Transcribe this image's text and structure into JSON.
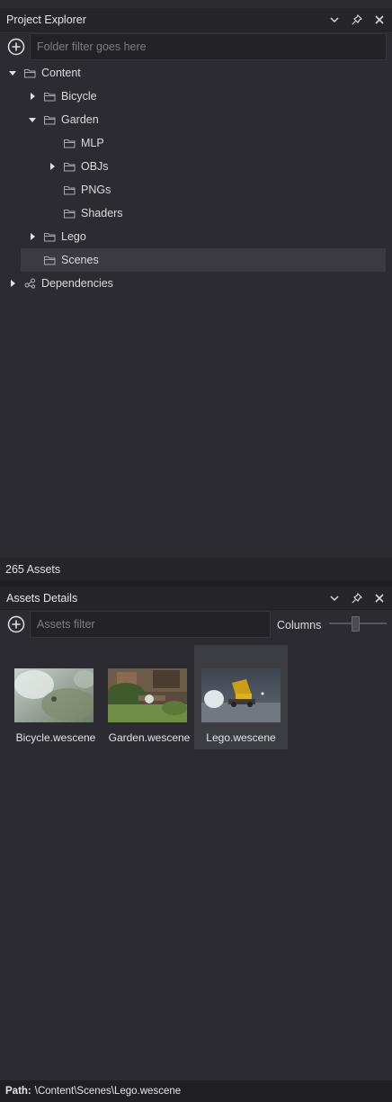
{
  "project_explorer": {
    "title": "Project Explorer",
    "filter_placeholder": "Folder filter goes here",
    "tree": [
      {
        "label": "Content",
        "depth": 0,
        "expanded": true,
        "has_children": true,
        "icon": "folder-icon"
      },
      {
        "label": "Bicycle",
        "depth": 1,
        "expanded": false,
        "has_children": true,
        "icon": "folder-icon"
      },
      {
        "label": "Garden",
        "depth": 1,
        "expanded": true,
        "has_children": true,
        "icon": "folder-icon"
      },
      {
        "label": "MLP",
        "depth": 2,
        "expanded": false,
        "has_children": false,
        "icon": "folder-icon"
      },
      {
        "label": "OBJs",
        "depth": 2,
        "expanded": false,
        "has_children": true,
        "icon": "folder-icon"
      },
      {
        "label": "PNGs",
        "depth": 2,
        "expanded": false,
        "has_children": false,
        "icon": "folder-icon"
      },
      {
        "label": "Shaders",
        "depth": 2,
        "expanded": false,
        "has_children": false,
        "icon": "folder-icon"
      },
      {
        "label": "Lego",
        "depth": 1,
        "expanded": false,
        "has_children": true,
        "icon": "folder-icon"
      },
      {
        "label": "Scenes",
        "depth": 1,
        "expanded": false,
        "has_children": false,
        "icon": "folder-icon",
        "selected": true
      },
      {
        "label": "Dependencies",
        "depth": 0,
        "expanded": false,
        "has_children": true,
        "icon": "dependencies-icon"
      }
    ]
  },
  "status": {
    "asset_count": "265 Assets"
  },
  "assets_details": {
    "title": "Assets Details",
    "filter_placeholder": "Assets filter",
    "columns_label": "Columns",
    "columns_slider_level": 0.45,
    "assets": [
      {
        "name": "Bicycle.wescene",
        "thumb": "bicycle",
        "selected": false
      },
      {
        "name": "Garden.wescene",
        "thumb": "garden",
        "selected": false
      },
      {
        "name": "Lego.wescene",
        "thumb": "lego",
        "selected": true
      }
    ]
  },
  "path_bar": {
    "label": "Path:",
    "value": "\\Content\\Scenes\\Lego.wescene"
  },
  "colors": {
    "background": "#2b2b31",
    "header": "#25252a",
    "selected_row": "#3a3a40",
    "text": "#dcdce0"
  }
}
